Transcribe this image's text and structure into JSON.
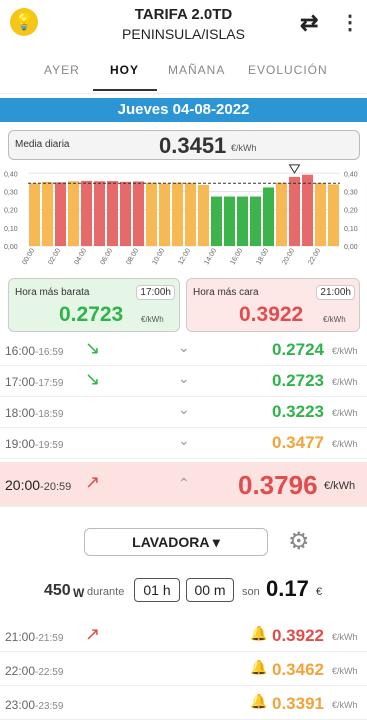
{
  "header": {
    "title": "TARIFA 2.0TD",
    "subtitle": "PENINSULA/ISLAS",
    "logo_icon": "lightbulb-icon",
    "sync_icon": "sync-icon",
    "more_icon": "more-vert-icon"
  },
  "tabs": [
    {
      "label": "AYER"
    },
    {
      "label": "HOY"
    },
    {
      "label": "MAÑANA"
    },
    {
      "label": "EVOLUCIÓN"
    }
  ],
  "date_header": "Jueves  04-08-2022",
  "average": {
    "label": "Media diaria",
    "value": "0.3451",
    "unit": "€/kWh"
  },
  "chart_data": {
    "type": "bar",
    "categories": [
      "00:00",
      "01:00",
      "02:00",
      "03:00",
      "04:00",
      "05:00",
      "06:00",
      "07:00",
      "08:00",
      "09:00",
      "10:00",
      "11:00",
      "12:00",
      "13:00",
      "14:00",
      "15:00",
      "16:00",
      "17:00",
      "18:00",
      "19:00",
      "20:00",
      "21:00",
      "22:00",
      "23:00"
    ],
    "x_tick_labels": [
      "00:00",
      "02:00",
      "04:00",
      "06:00",
      "08:00",
      "10:00",
      "12:00",
      "14:00",
      "16:00",
      "18:00",
      "20:00",
      "22:00"
    ],
    "y_tick_labels": [
      "0,00",
      "0,10",
      "0,20",
      "0,30",
      "0,40"
    ],
    "values": [
      0.345,
      0.352,
      0.35,
      0.356,
      0.358,
      0.356,
      0.357,
      0.353,
      0.355,
      0.349,
      0.344,
      0.349,
      0.347,
      0.336,
      0.272,
      0.272,
      0.272,
      0.272,
      0.322,
      0.348,
      0.38,
      0.392,
      0.346,
      0.339
    ],
    "colors": [
      "#f7b955",
      "#f7b955",
      "#e66a6a",
      "#f7b955",
      "#e66a6a",
      "#e66a6a",
      "#e66a6a",
      "#e66a6a",
      "#e66a6a",
      "#f7b955",
      "#f7b955",
      "#f7b955",
      "#f7b955",
      "#f7b955",
      "#3cb44b",
      "#3cb44b",
      "#3cb44b",
      "#3cb44b",
      "#3cb44b",
      "#f7b955",
      "#e66a6a",
      "#e66a6a",
      "#f7b955",
      "#f7b955"
    ],
    "average_line": 0.3451,
    "ylim": [
      0,
      0.44
    ],
    "marker_index": 20,
    "grid": true
  },
  "cheapest": {
    "label": "Hora más barata",
    "hour": "17:00h",
    "value": "0.2723",
    "unit": "€/kWh"
  },
  "most_expensive": {
    "label": "Hora más cara",
    "hour": "21:00h",
    "value": "0.3922",
    "unit": "€/kWh"
  },
  "rows": [
    {
      "start": "16:00",
      "end": "-16:59",
      "price": "0.2724",
      "unit": "€/kWh",
      "trend": "down"
    },
    {
      "start": "17:00",
      "end": "-17:59",
      "price": "0.2723",
      "unit": "€/kWh",
      "trend": "down"
    },
    {
      "start": "18:00",
      "end": "-18:59",
      "price": "0.3223",
      "unit": "€/kWh"
    },
    {
      "start": "19:00",
      "end": "-19:59",
      "price": "0.3477",
      "unit": "€/kWh"
    },
    {
      "start": "20:00",
      "end": "-20:59",
      "price": "0.3796",
      "unit": "€/kWh",
      "trend": "up"
    },
    {
      "start": "21:00",
      "end": "-21:59",
      "price": "0.3922",
      "unit": "€/kWh",
      "trend": "up"
    },
    {
      "start": "22:00",
      "end": "-22:59",
      "price": "0.3462",
      "unit": "€/kWh"
    },
    {
      "start": "23:00",
      "end": "-23:59",
      "price": "0.3391",
      "unit": "€/kWh"
    }
  ],
  "appliance": {
    "name": "LAVADORA",
    "power": "450",
    "power_unit": "W",
    "during_label": "durante",
    "hours": "01 h",
    "minutes": "00 m",
    "son_label": "son",
    "cost": "0.17",
    "currency": "€"
  }
}
